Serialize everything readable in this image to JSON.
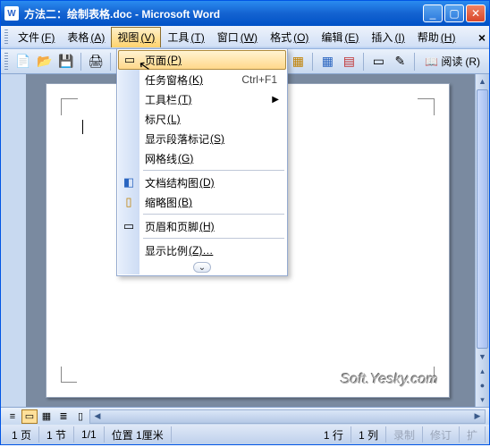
{
  "window": {
    "title": "方法二：绘制表格.doc - Microsoft Word",
    "app_icon": "W"
  },
  "menubar": {
    "items": [
      {
        "label": "文件",
        "accel": "(F)"
      },
      {
        "label": "表格",
        "accel": "(A)"
      },
      {
        "label": "视图",
        "accel": "(V)"
      },
      {
        "label": "工具",
        "accel": "(T)"
      },
      {
        "label": "窗口",
        "accel": "(W)"
      },
      {
        "label": "格式",
        "accel": "(O)"
      },
      {
        "label": "编辑",
        "accel": "(E)"
      },
      {
        "label": "插入",
        "accel": "(I)"
      },
      {
        "label": "帮助",
        "accel": "(H)"
      }
    ]
  },
  "toolbar": {
    "reading_label": "阅读",
    "reading_accel": "(R)"
  },
  "dropdown": {
    "items": [
      {
        "icon": "page-icon",
        "label": "页面",
        "accel": "(P)",
        "highlighted": true
      },
      {
        "icon": "",
        "label": "任务窗格",
        "accel": "(K)",
        "shortcut": "Ctrl+F1"
      },
      {
        "icon": "",
        "label": "工具栏",
        "accel": "(T)",
        "submenu": true
      },
      {
        "icon": "",
        "label": "标尺",
        "accel": "(L)"
      },
      {
        "icon": "",
        "label": "显示段落标记",
        "accel": "(S)"
      },
      {
        "icon": "",
        "label": "网格线",
        "accel": "(G)"
      },
      {
        "icon": "docmap-icon",
        "label": "文档结构图",
        "accel": "(D)"
      },
      {
        "icon": "thumb-icon",
        "label": "缩略图",
        "accel": "(B)"
      },
      {
        "icon": "hf-icon",
        "label": "页眉和页脚",
        "accel": "(H)"
      },
      {
        "icon": "",
        "label": "显示比例",
        "accel": "(Z)…"
      }
    ]
  },
  "watermark": "Soft.Yesky.com",
  "statusbar": {
    "page": "1 页",
    "section": "1 节",
    "pages": "1/1",
    "position": "位置 1厘米",
    "line": "1 行",
    "col": "1 列",
    "rec": "录制",
    "rev": "修订",
    "ext": "扩"
  }
}
